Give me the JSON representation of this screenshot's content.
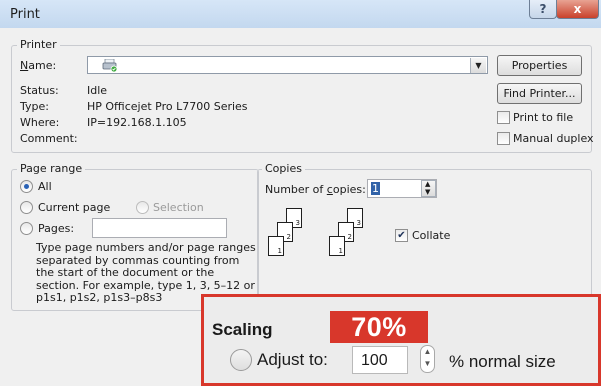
{
  "window": {
    "title": "Print",
    "help_label": "?",
    "close_label": "x"
  },
  "printer": {
    "group_label": "Printer",
    "name_label": "Name:",
    "status_label": "Status:",
    "status_value": "Idle",
    "type_label": "Type:",
    "type_value": "HP Officejet Pro L7700 Series",
    "where_label": "Where:",
    "where_value": "IP=192.168.1.105",
    "comment_label": "Comment:",
    "properties_button": "Properties",
    "find_printer_button": "Find Printer...",
    "print_to_file_label": "Print to file",
    "manual_duplex_label": "Manual duplex",
    "print_to_file_checked": false,
    "manual_duplex_checked": false
  },
  "page_range": {
    "group_label": "Page range",
    "all_label": "All",
    "current_page_label": "Current page",
    "selection_label": "Selection",
    "pages_label": "Pages:",
    "pages_value": "",
    "selected": "All",
    "description": "Type page numbers and/or page ranges separated by commas counting from the start of the document or the section. For example, type 1, 3, 5–12 or p1s1, p1s2, p1s3–p8s3"
  },
  "copies": {
    "group_label": "Copies",
    "number_label": "Number of copies:",
    "number_value": "1",
    "collate_label": "Collate",
    "collate_checked": true,
    "page_numbers": [
      "1",
      "2",
      "3"
    ]
  },
  "zoom_overlay": {
    "badge": "70%",
    "scaling_label": "Scaling",
    "adjust_label": "Adjust to:",
    "adjust_value": "100",
    "suffix": "% normal size",
    "accent_color": "#d8372b"
  }
}
